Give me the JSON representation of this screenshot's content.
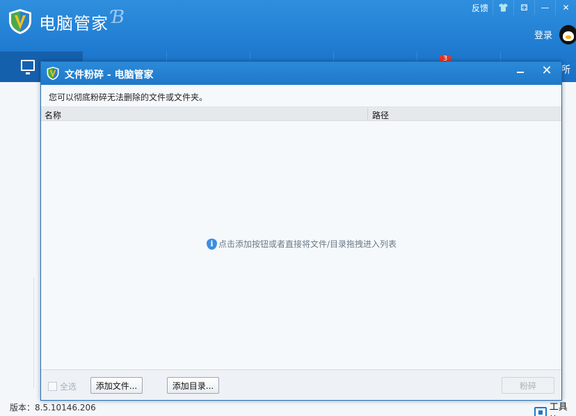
{
  "app": {
    "title": "电脑管家",
    "swirl": "Ɓ",
    "top_links": [
      "反馈",
      "👕",
      "⚃",
      "—",
      "✕"
    ],
    "login": "登录",
    "nav_badge": "3",
    "nav_edge_text": "所",
    "version": "版本：8.5.10146.206",
    "toolbox": "工具箱"
  },
  "dialog": {
    "title": "文件粉碎 - 电脑管家",
    "minimize": "",
    "close": "✕",
    "description": "您可以彻底粉碎无法删除的文件或文件夹。",
    "columns": {
      "name": "名称",
      "path": "路径"
    },
    "empty_hint": "点击添加按钮或者直接将文件/目录拖拽进入列表",
    "info_glyph": "i",
    "select_all": "全选",
    "add_file": "添加文件...",
    "add_dir": "添加目录...",
    "shred": "粉碎"
  },
  "colors": {
    "header_blue": "#1f7bd0",
    "active_tab": "#1560ad",
    "badge_red": "#e2382a",
    "info_blue": "#3d8ee0"
  }
}
